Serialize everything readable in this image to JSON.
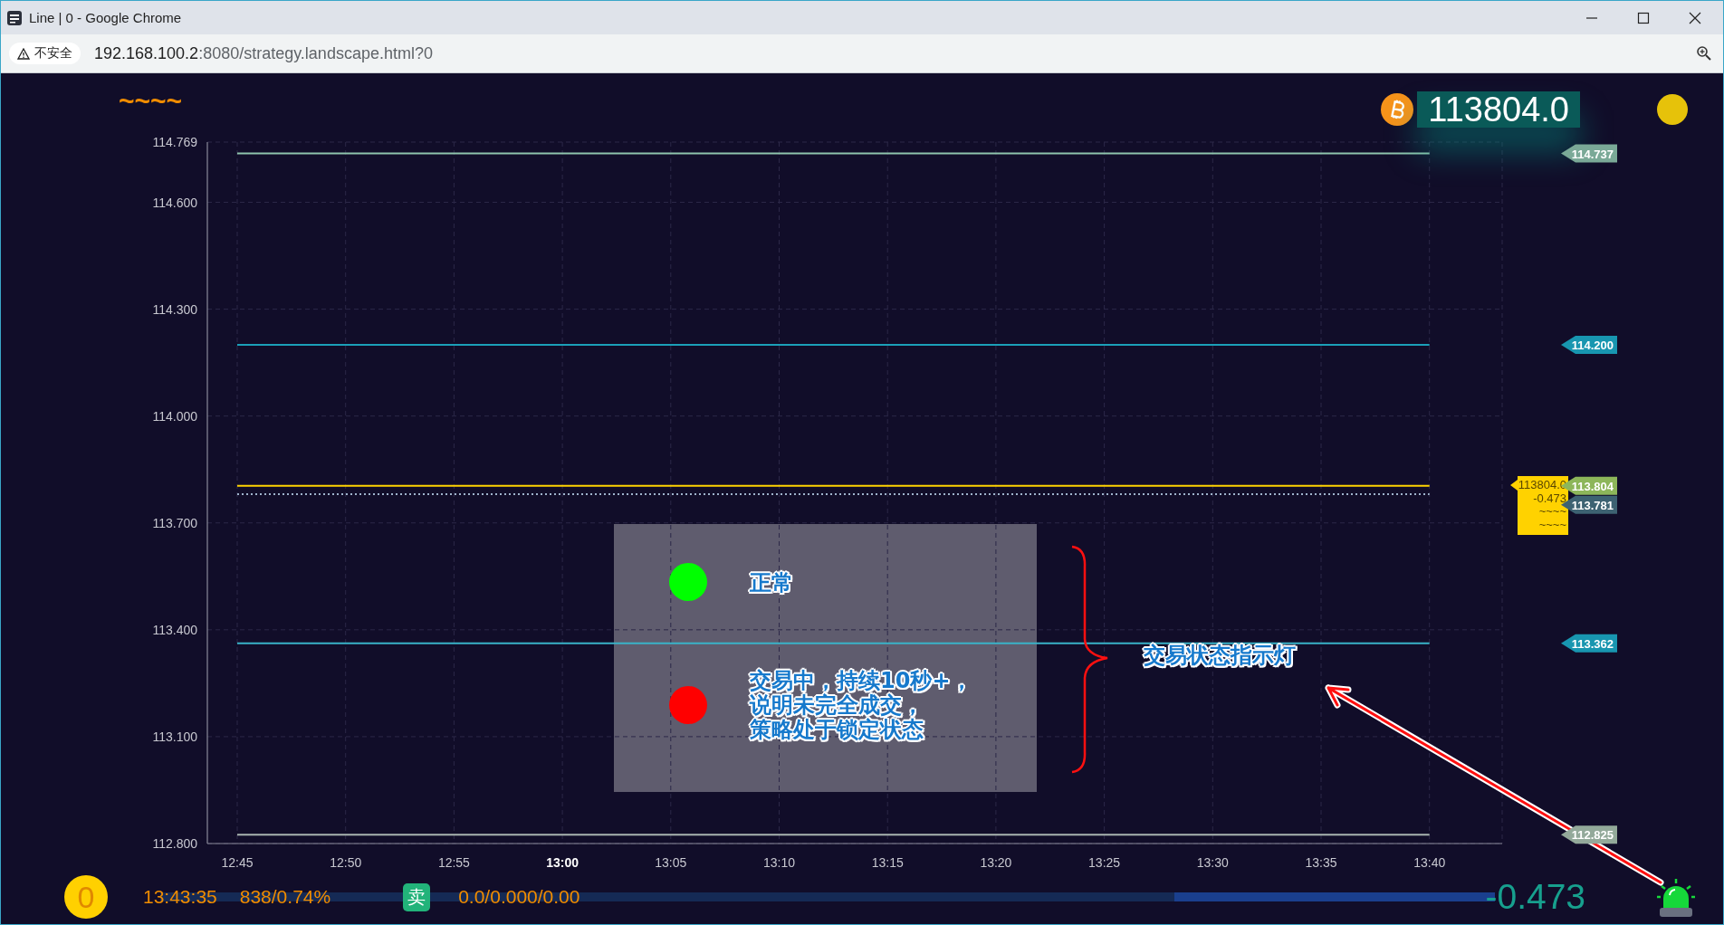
{
  "window": {
    "title": "Line | 0 - Google Chrome"
  },
  "address_bar": {
    "security": "不安全",
    "url_host": "192.168.100.2",
    "url_path": ":8080/strategy.landscape.html?0"
  },
  "header": {
    "symbol_mark": "~~~~",
    "price": "113804.0"
  },
  "chart": {
    "chart_data": {
      "type": "line",
      "categories": [
        "12:45",
        "12:50",
        "12:55",
        "13:00",
        "13:05",
        "13:10",
        "13:15",
        "13:20",
        "13:25",
        "13:30",
        "13:35",
        "13:40"
      ],
      "ylim": [
        112.8,
        114.769
      ],
      "grid": true,
      "yticks": [
        {
          "value": 114.769,
          "label": "114.769"
        },
        {
          "value": 114.6,
          "label": "114.600"
        },
        {
          "value": 114.3,
          "label": "114.300"
        },
        {
          "value": 114.0,
          "label": "114.000"
        },
        {
          "value": 113.7,
          "label": "113.700"
        },
        {
          "value": 113.4,
          "label": "113.400"
        },
        {
          "value": 113.1,
          "label": "113.100"
        },
        {
          "value": 112.8,
          "label": "112.800"
        }
      ],
      "series": [
        {
          "color": "#8fc4ad",
          "line_style": "solid",
          "values": [
            114.737,
            114.737,
            114.737,
            114.737,
            114.737,
            114.737,
            114.737,
            114.737,
            114.737,
            114.737,
            114.737,
            114.737
          ]
        },
        {
          "color": "#1b9fb8",
          "line_style": "solid",
          "values": [
            114.2,
            114.2,
            114.2,
            114.2,
            114.2,
            114.2,
            114.2,
            114.2,
            114.2,
            114.2,
            114.2,
            114.2
          ]
        },
        {
          "color": "#ffd400",
          "line_style": "solid",
          "values": [
            113.804,
            113.804,
            113.804,
            113.804,
            113.804,
            113.804,
            113.804,
            113.804,
            113.804,
            113.804,
            113.804,
            113.804
          ]
        },
        {
          "color": "#9fb4cc",
          "line_style": "dotted",
          "values": [
            113.781,
            113.781,
            113.781,
            113.781,
            113.781,
            113.781,
            113.781,
            113.781,
            113.781,
            113.781,
            113.781,
            113.781
          ]
        },
        {
          "color": "#39b3c8",
          "line_style": "solid",
          "values": [
            113.362,
            113.362,
            113.362,
            113.362,
            113.362,
            113.362,
            113.362,
            113.362,
            113.362,
            113.362,
            113.362,
            113.362
          ]
        },
        {
          "color": "#a8b4b0",
          "line_style": "solid",
          "values": [
            112.825,
            112.825,
            112.825,
            112.825,
            112.825,
            112.825,
            112.825,
            112.825,
            112.825,
            112.825,
            112.825,
            112.825
          ]
        }
      ]
    },
    "x_label_styles": [
      {
        "bold": false
      },
      {
        "bold": false
      },
      {
        "bold": false
      },
      {
        "bold": true
      },
      {
        "bold": false
      },
      {
        "bold": false
      },
      {
        "bold": false
      },
      {
        "bold": false
      },
      {
        "bold": false
      },
      {
        "bold": false
      },
      {
        "bold": false
      },
      {
        "bold": false
      }
    ],
    "price_tags": [
      {
        "label": "114.737",
        "color": "#7aa997"
      },
      {
        "label": "114.200",
        "color": "#1896b0"
      },
      {
        "label": "113.804",
        "color": "#8db65a"
      },
      {
        "label": "113.781",
        "color": "#3d6272"
      },
      {
        "label": "113.362",
        "color": "#1896b0"
      },
      {
        "label": "112.825",
        "color": "#93a99a"
      }
    ],
    "callout": [
      "113804.0",
      "-0.473",
      "~~~~",
      "~~~~"
    ]
  },
  "annotation": {
    "legend": [
      {
        "color": "#00ff00",
        "lines": [
          "正常"
        ]
      },
      {
        "color": "#ff0000",
        "lines": [
          "交易中，持续10秒+，",
          "说明未完全成交，",
          "策略处于锁定状态"
        ]
      }
    ],
    "label": "交易状态指示灯"
  },
  "status_bar": {
    "counter": "0",
    "time": "13:43:35",
    "ratio": "838/0.74%",
    "side": "卖",
    "position": "0.0/0.000/0.00",
    "level": 0.24,
    "change": "-0.473"
  }
}
